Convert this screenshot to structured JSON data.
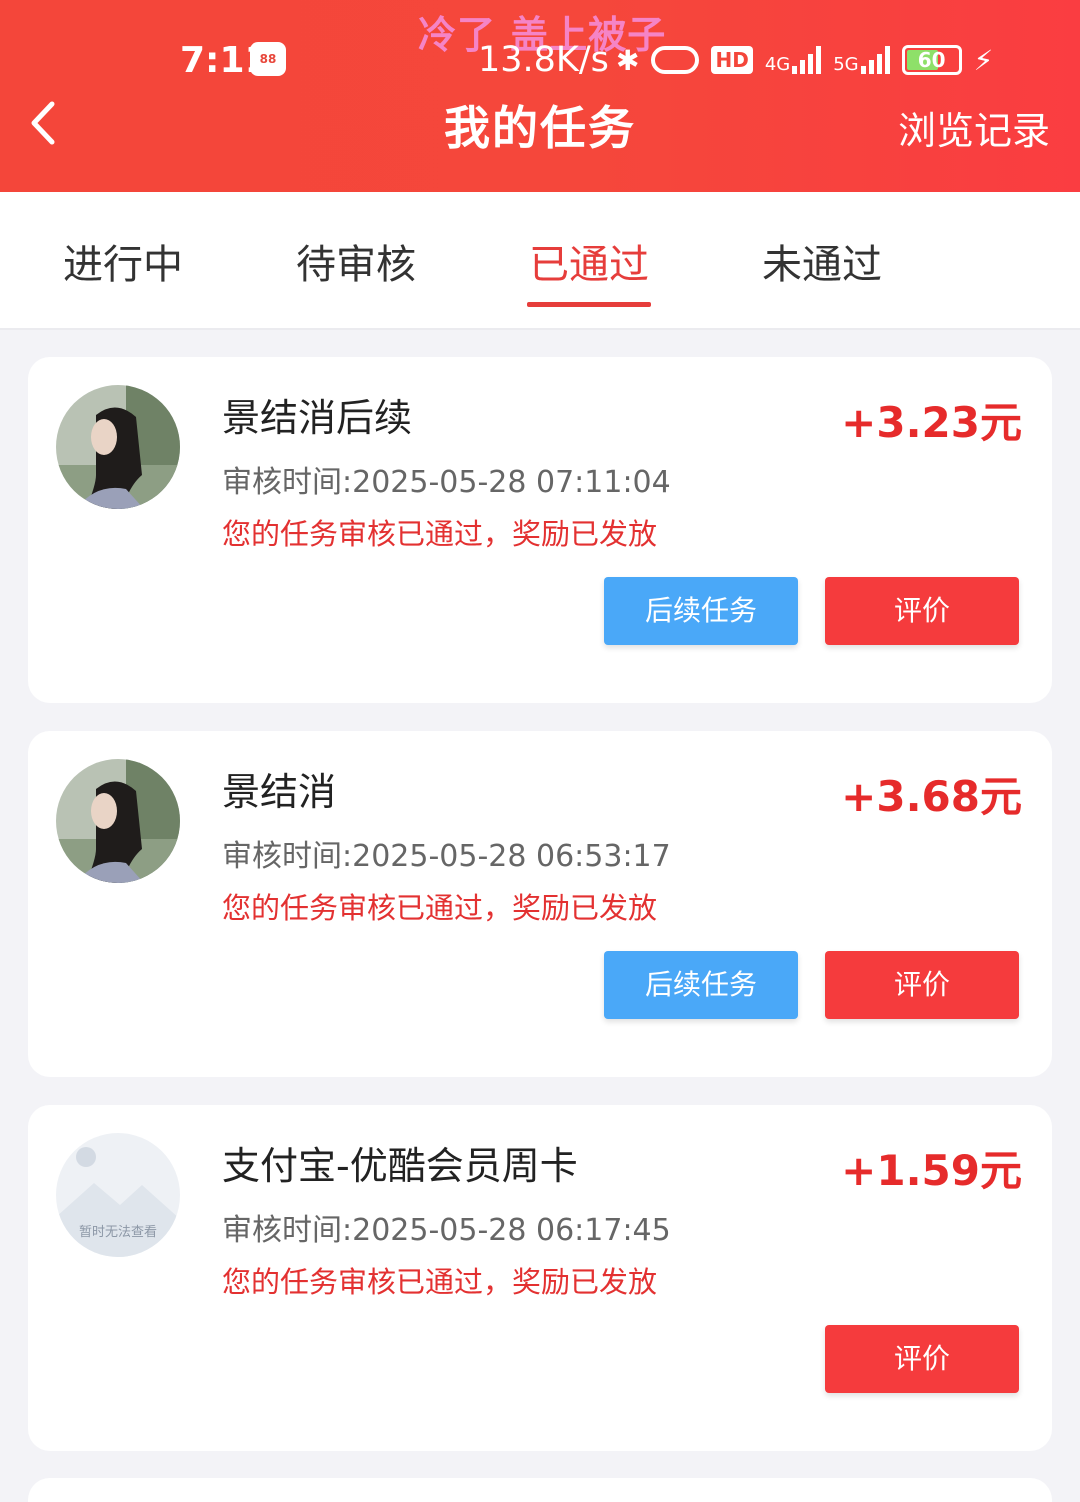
{
  "status_bar": {
    "watermark": "冷了 盖上被子",
    "time": "7:11",
    "app_icon_label": "88",
    "net_speed": "13.8K/s",
    "hd_label": "HD",
    "net_4g": "4G",
    "net_5g": "5G",
    "battery": "60",
    "bluetooth": "✱",
    "charging": "⚡"
  },
  "header": {
    "title": "我的任务",
    "history": "浏览记录"
  },
  "tabs": [
    {
      "label": "进行中"
    },
    {
      "label": "待审核"
    },
    {
      "label": "已通过"
    },
    {
      "label": "未通过"
    }
  ],
  "active_tab": "已通过",
  "tasks": [
    {
      "title": "景结消后续",
      "reward": "+3.23元",
      "review_time": "审核时间:2025-05-28 07:11:04",
      "status": "您的任务审核已通过，奖励已发放",
      "follow_label": "后续任务",
      "rate_label": "评价"
    },
    {
      "title": "景结消",
      "reward": "+3.68元",
      "review_time": "审核时间:2025-05-28 06:53:17",
      "status": "您的任务审核已通过，奖励已发放",
      "follow_label": "后续任务",
      "rate_label": "评价"
    },
    {
      "title": "支付宝-优酷会员周卡",
      "reward": "+1.59元",
      "review_time": "审核时间:2025-05-28 06:17:45",
      "status": "您的任务审核已通过，奖励已发放",
      "rate_label": "评价",
      "placeholder_text": "暂时无法查看"
    }
  ],
  "colors": {
    "header_red": "#f4463a",
    "accent_red": "#e63d3b",
    "reward_red": "#e62b2b",
    "follow_blue": "#4aa8f8",
    "rate_red": "#f53b3d",
    "page_bg": "#f3f3f7"
  },
  "icons": {
    "back": "chevron-left-icon",
    "bluetooth": "bluetooth-icon",
    "battery": "battery-icon",
    "avatar_placeholder": "image-placeholder-icon"
  }
}
